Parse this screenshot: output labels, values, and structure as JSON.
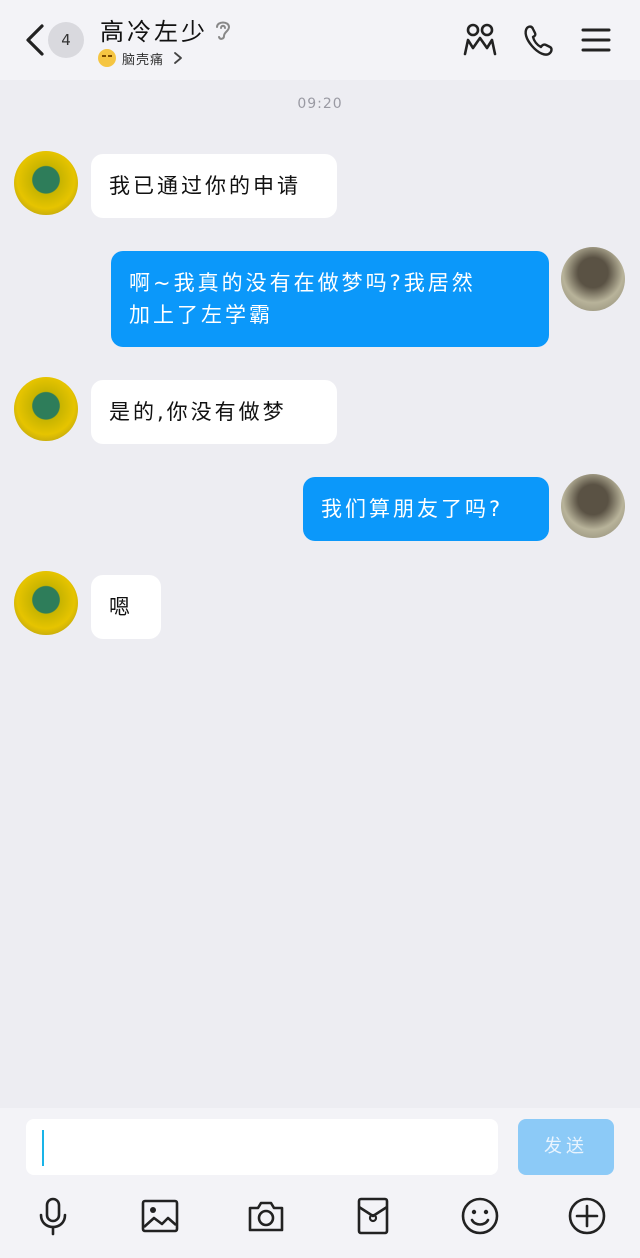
{
  "header": {
    "unread_count": "4",
    "contact_name": "高冷左少",
    "status_text": "脑壳痛"
  },
  "chat": {
    "timestamp": "09:20",
    "messages": [
      {
        "sender": "peer",
        "text": "我已通过你的申请"
      },
      {
        "sender": "self",
        "line1": "啊~我真的没有在做梦吗?我居然",
        "line2": "加上了左学霸"
      },
      {
        "sender": "peer",
        "text": "是的,你没有做梦"
      },
      {
        "sender": "self",
        "text": "我们算朋友了吗?"
      },
      {
        "sender": "peer",
        "text": "嗯"
      }
    ]
  },
  "composer": {
    "input_value": "",
    "send_label": "发送"
  },
  "icons": {
    "header": [
      "back-icon",
      "hearing-icon",
      "friends-icon",
      "phone-icon",
      "menu-icon"
    ],
    "toolbar": [
      "microphone-icon",
      "image-icon",
      "camera-icon",
      "red-packet-icon",
      "emoji-icon",
      "plus-icon"
    ]
  },
  "colors": {
    "background": "#ededf2",
    "self_bubble": "#0b98fa",
    "peer_bubble": "#ffffff",
    "send_button": "#8ccaf7"
  }
}
